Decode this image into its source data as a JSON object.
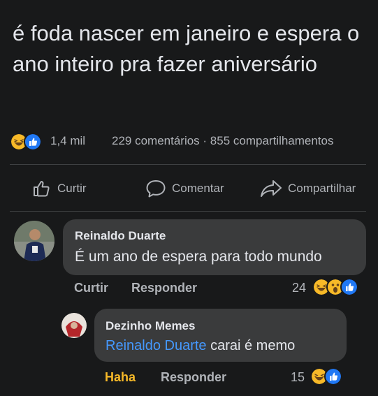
{
  "post": {
    "text": "é foda nascer em janeiro e espera o ano inteiro pra fazer aniversário",
    "reaction_icons": [
      "haha-emoji-icon",
      "like-thumb-icon"
    ],
    "reaction_count": "1,4 mil",
    "comments_shares": "229 comentários · 855 compartilhamentos"
  },
  "actions": {
    "like": "Curtir",
    "comment": "Comentar",
    "share": "Compartilhar"
  },
  "comments": [
    {
      "author": "Reinaldo Duarte",
      "text": "É um ano de espera para todo mundo",
      "like_label": "Curtir",
      "reply_label": "Responder",
      "reaction_count": "24",
      "reaction_icons": [
        "haha-emoji-icon",
        "wow-emoji-icon",
        "like-thumb-icon"
      ]
    },
    {
      "author": "Dezinho Memes",
      "mention": "Reinaldo Duarte",
      "text": "carai é memo",
      "reaction_label": "Haha",
      "reply_label": "Responder",
      "reaction_count": "15",
      "reaction_icons": [
        "haha-emoji-icon",
        "like-thumb-icon"
      ]
    }
  ],
  "colors": {
    "background": "#18191a",
    "bubble": "#3a3b3c",
    "text": "#e4e6eb",
    "secondary_text": "#b0b3b8",
    "mention": "#4599ff",
    "haha_active": "#f7b928",
    "like_blue": "#2078f4"
  }
}
